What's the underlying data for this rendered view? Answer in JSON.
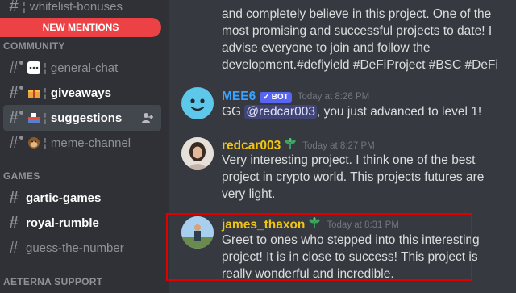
{
  "sidebar": {
    "top_channel": "whitelist-bonuses",
    "new_mentions": "NEW MENTIONS",
    "categories": {
      "community": "COMMUNITY",
      "games": "GAMES",
      "support": "AETERNA SUPPORT"
    },
    "channels": {
      "general_chat": "general-chat",
      "giveaways": "giveaways",
      "suggestions": "suggestions",
      "meme_channel": "meme-channel",
      "gartic_games": "gartic-games",
      "royal_rumble": "royal-rumble",
      "guess_the_number": "guess-the-number"
    },
    "separator": "¦",
    "add_member_icon": "add-member-icon"
  },
  "chat": {
    "prev_message_lines": [
      "and completely believe in this project. One of the",
      "most promising and successful projects to date! I",
      "advise everyone to join and follow the",
      "development.#defiyield #DeFiProject #BSC #DeFi"
    ],
    "messages": [
      {
        "username": "MEE6",
        "user_color": "#3ba3ff",
        "bot_label": "BOT",
        "timestamp": "Today at 8:26 PM",
        "text_before": "GG ",
        "mention": "@redcar003",
        "text_after": ", you just advanced to level 1!"
      },
      {
        "username": "redcar003",
        "user_color": "#f1c40f",
        "timestamp": "Today at 8:27 PM",
        "lines": [
          "Very interesting project. I think one of the best",
          "project in crypto world. This projects futures are",
          "very light."
        ]
      },
      {
        "username": "james_thaxon",
        "user_color": "#f1c40f",
        "timestamp": "Today at 8:31 PM",
        "lines": [
          "Greet to ones who stepped into this interesting",
          "project!  It is in close to success! This project is",
          "really wonderful and incredible."
        ]
      }
    ]
  },
  "colors": {
    "sidebar_bg": "#2f3136",
    "chat_bg": "#36393f",
    "mention_red": "#ed4245",
    "highlight_box": "#e00000",
    "bot_badge": "#5865f2"
  }
}
